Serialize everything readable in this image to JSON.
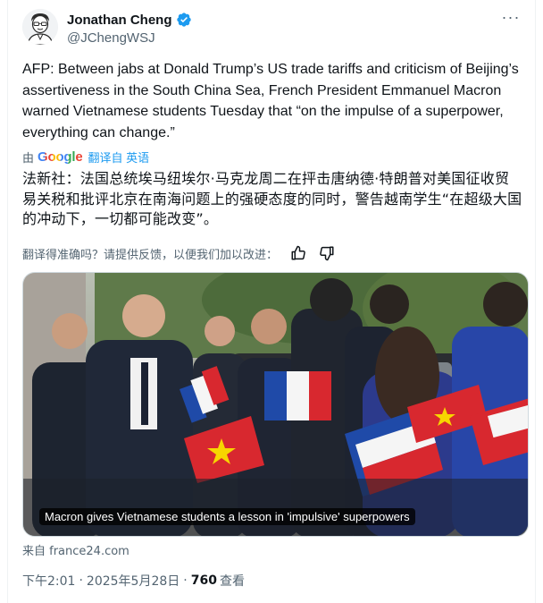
{
  "author": {
    "name": "Jonathan Cheng",
    "handle": "@JChengWSJ"
  },
  "tweet": {
    "text": "AFP: Between jabs at Donald Trump’s US trade tariffs and criticism of Beijing’s assertiveness in the South China Sea, French President Emmanuel Macron warned Vietnamese students Tuesday that “on the impulse of a superpower, everything can change.”"
  },
  "translation": {
    "by_prefix": "由",
    "provider": "Google",
    "link_label": "翻译自 英语",
    "text": "法新社：法国总统埃马纽埃尔·马克龙周二在抨击唐纳德·特朗普对美国征收贸易关税和批评北京在南海问题上的强硬态度的同时，警告越南学生“在超级大国的冲动下，一切都可能改变”。",
    "feedback_prompt": "翻译得准确吗？请提供反馈，以便我们加以改进："
  },
  "media": {
    "caption": "Macron gives Vietnamese students a lesson in 'impulsive' superpowers"
  },
  "source": "来自 france24.com",
  "meta": {
    "time": "下午2:01",
    "date": "2025年5月28日",
    "views_count": "760",
    "views_label": "查看"
  },
  "colors": {
    "accent": "#1d9bf0",
    "secondary_text": "#536471"
  }
}
